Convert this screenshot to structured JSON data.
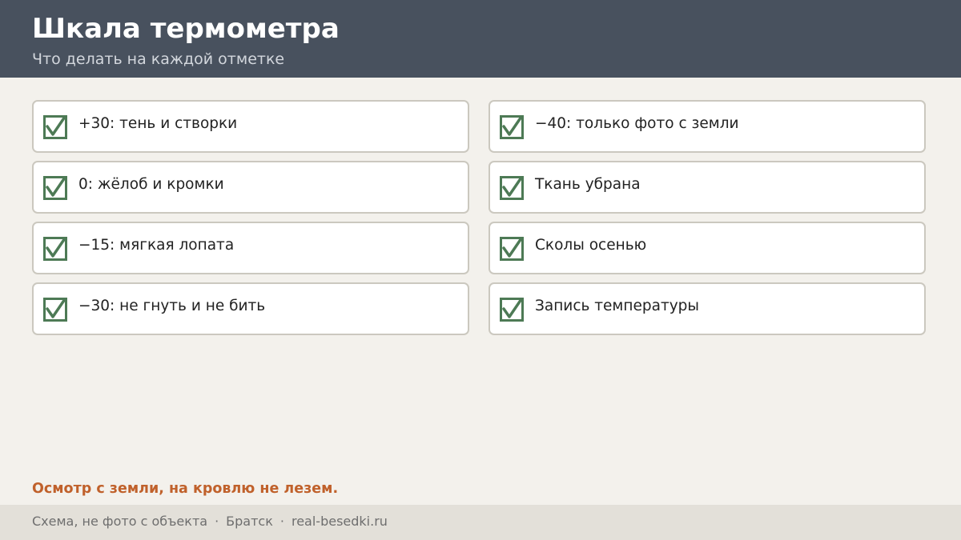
{
  "header": {
    "title": "Шкала термометра",
    "subtitle": "Что делать на каждой отметке"
  },
  "checklist": {
    "left": [
      {
        "label": "+30: тень и створки",
        "checked": true
      },
      {
        "label": "0: жёлоб и кромки",
        "checked": true
      },
      {
        "label": "−15: мягкая лопата",
        "checked": true
      },
      {
        "label": "−30: не гнуть и не бить",
        "checked": true
      }
    ],
    "right": [
      {
        "label": "−40: только фото с земли",
        "checked": true
      },
      {
        "label": "Ткань убрана",
        "checked": true
      },
      {
        "label": "Сколы осенью",
        "checked": true
      },
      {
        "label": "Запись температуры",
        "checked": true
      }
    ]
  },
  "note": "Осмотр с земли, на кровлю не лезем.",
  "footer": {
    "disclaimer": "Схема, не фото с объекта",
    "separator": "·",
    "city": "Братск",
    "site": "real-besedki.ru"
  },
  "colors": {
    "header_bg": "#48515e",
    "check_green": "#4d7a55",
    "accent_orange": "#c0612b",
    "page_bg": "#f3f1ec"
  },
  "icons": {
    "checkbox": "checked-checkbox-icon"
  }
}
